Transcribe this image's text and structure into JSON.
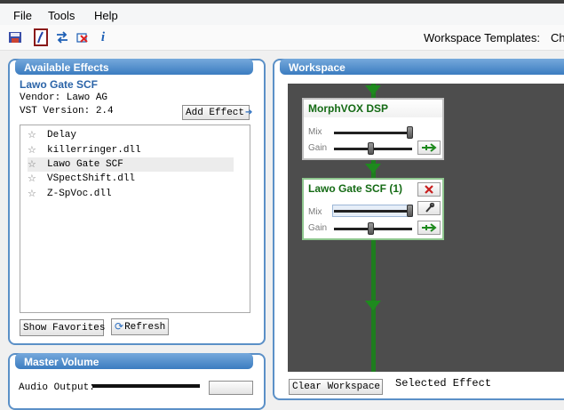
{
  "menu": {
    "file": "File",
    "tools": "Tools",
    "help": "Help"
  },
  "toolbar": {
    "workspace_templates_label": "Workspace Templates:",
    "workspace_templates_value": "Ch"
  },
  "available_effects": {
    "title": "Available Effects",
    "selected_name": "Lawo Gate SCF",
    "vendor": "Vendor: Lawo AG",
    "vst_version": "VST Version: 2.4",
    "add_effect_label": "Add Effect",
    "items": [
      {
        "name": "Delay"
      },
      {
        "name": "killerringer.dll"
      },
      {
        "name": "Lawo Gate SCF",
        "selected": true
      },
      {
        "name": "VSpectShift.dll"
      },
      {
        "name": "Z-SpVoc.dll"
      }
    ],
    "show_favorites_label": "Show Favorites",
    "refresh_label": "Refresh"
  },
  "master_volume": {
    "title": "Master Volume",
    "audio_output_label": "Audio Output:"
  },
  "workspace": {
    "title": "Workspace",
    "effects": [
      {
        "name": "MorphVOX DSP",
        "mix_label": "Mix",
        "gain_label": "Gain",
        "mix_level": 1.0,
        "gain_level": 0.5
      },
      {
        "name": "Lawo Gate SCF (1)",
        "mix_label": "Mix",
        "gain_label": "Gain",
        "mix_level": 1.0,
        "gain_level": 0.5
      }
    ],
    "clear_workspace_label": "Clear Workspace",
    "selected_effect_label": "Selected Effect"
  },
  "colors": {
    "accent": "#3b7cc0",
    "wire": "#1e7d1e"
  }
}
